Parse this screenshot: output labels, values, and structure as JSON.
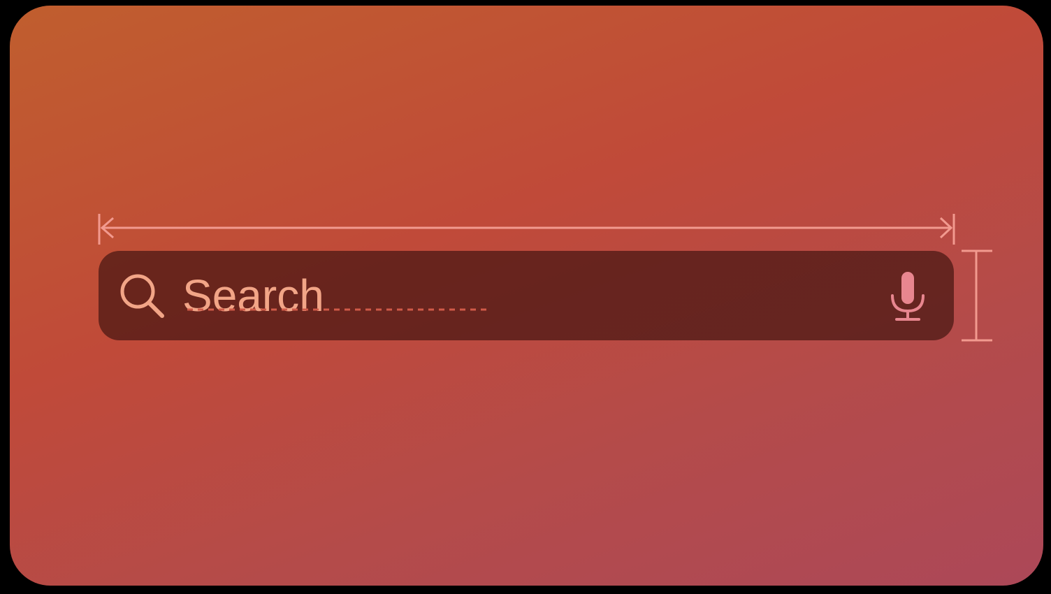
{
  "search": {
    "placeholder": "Search",
    "leading_icon": "search-icon",
    "trailing_icon": "mic-icon"
  },
  "colors": {
    "background": "#000000",
    "card_gradient_start": "#c05e2e",
    "card_gradient_end": "#ac4858",
    "search_field_fill": "#6c2a22",
    "foreground": "#f2a587",
    "guide": "#f29a8f"
  }
}
